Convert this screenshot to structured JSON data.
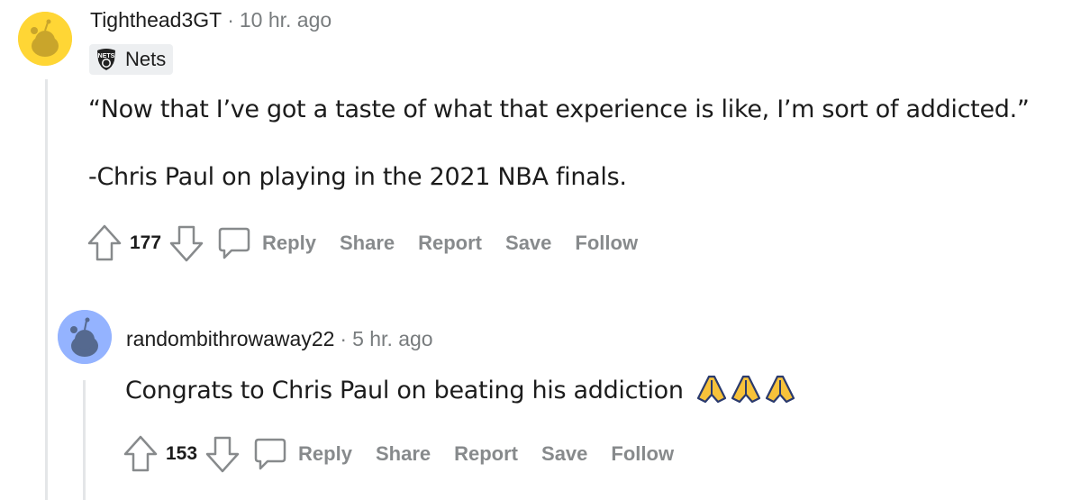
{
  "comments": [
    {
      "username": "Tighthead3GT",
      "time": "10 hr. ago",
      "flair": "Nets",
      "lines": [
        "“Now that I’ve got a taste of what that experience is like, I’m sort of addicted.”",
        "-Chris Paul on playing in the 2021 NBA finals."
      ],
      "score": "177",
      "actions": {
        "reply": "Reply",
        "share": "Share",
        "report": "Report",
        "save": "Save",
        "follow": "Follow"
      },
      "avatar_color": "#ffd635"
    },
    {
      "username": "randombithrowaway22",
      "time": "5 hr. ago",
      "lines": [
        "Congrats to Chris Paul on beating his addiction"
      ],
      "emoji": "🙏🙏🙏",
      "score": "153",
      "actions": {
        "reply": "Reply",
        "share": "Share",
        "report": "Report",
        "save": "Save",
        "follow": "Follow"
      },
      "avatar_color": "#94b3ff"
    }
  ],
  "icons": [
    "upvote-icon",
    "downvote-icon",
    "comment-bubble-icon",
    "nets-logo-icon",
    "snoo-avatar-icon",
    "folded-hands-emoji"
  ],
  "colors": {
    "meta_gray": "#787c7e",
    "action_gray": "#878a8c",
    "thread_line": "#e4e6e8",
    "flair_bg": "#edeff1"
  }
}
